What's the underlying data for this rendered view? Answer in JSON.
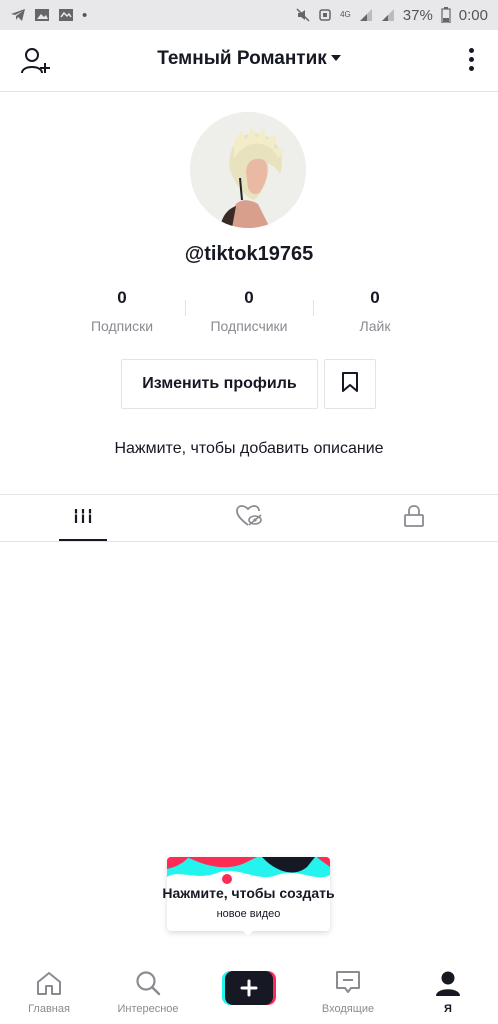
{
  "status_bar": {
    "battery": "37%",
    "time": "0:00",
    "network": "4G"
  },
  "header": {
    "title": "Темный Романтик"
  },
  "profile": {
    "username": "@tiktok19765",
    "stats": [
      {
        "value": "0",
        "label": "Подписки"
      },
      {
        "value": "0",
        "label": "Подписчики"
      },
      {
        "value": "0",
        "label": "Лайк"
      }
    ],
    "edit_label": "Изменить профиль",
    "bio_placeholder": "Нажмите, чтобы добавить описание"
  },
  "tabs": [
    {
      "icon": "grid-icon",
      "active": true
    },
    {
      "icon": "liked-hidden-icon",
      "active": false
    },
    {
      "icon": "lock-icon",
      "active": false
    }
  ],
  "tooltip": {
    "title": "Нажмите, чтобы создать",
    "subtitle": "новое видео"
  },
  "bottom_nav": [
    {
      "label": "Главная",
      "icon": "home-icon"
    },
    {
      "label": "Интересное",
      "icon": "search-icon"
    },
    {
      "label": "",
      "icon": "plus-icon"
    },
    {
      "label": "Входящие",
      "icon": "inbox-icon"
    },
    {
      "label": "Я",
      "icon": "profile-icon",
      "active": true
    }
  ],
  "colors": {
    "text": "#161823",
    "muted": "#8a8b91",
    "border": "#e3e3e4",
    "accent_red": "#fe2c55",
    "accent_cyan": "#25f4ee"
  }
}
